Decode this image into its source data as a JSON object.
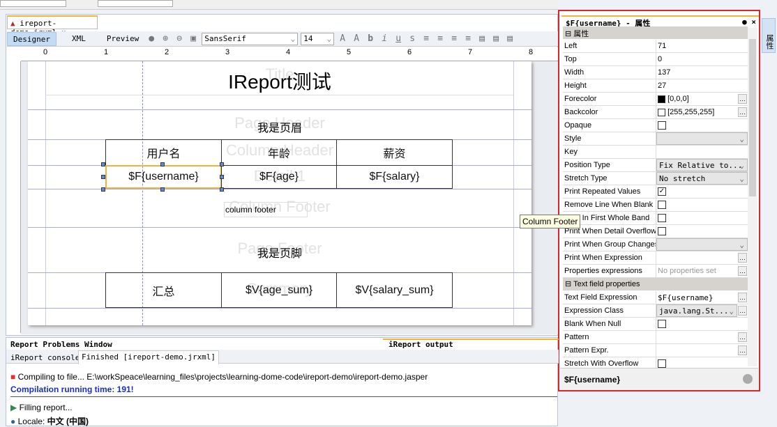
{
  "editor": {
    "file_tab": "ireport-demo.jrxml",
    "view_tabs": [
      "Designer",
      "XML",
      "Preview"
    ],
    "font_family": "SansSerif",
    "font_size": "14",
    "ruler_marks": [
      "0",
      "1",
      "2",
      "3",
      "4",
      "5",
      "6",
      "7",
      "8"
    ]
  },
  "report": {
    "band_labels": [
      "Title",
      "Page Header",
      "Column Header",
      "Detail 1",
      "Column Footer",
      "Page Footer",
      "Summary"
    ],
    "title": "IReport测试",
    "page_header": "我是页眉",
    "column_headers": [
      "用户名",
      "年龄",
      "薪资"
    ],
    "detail_fields": [
      "$F{username}",
      "$F{age}",
      "$F{salary}"
    ],
    "column_footer": "column footer",
    "page_footer": "我是页脚",
    "summary": [
      "汇总",
      "$V{age_sum}",
      "$V{salary_sum}"
    ],
    "tooltip": "Column Footer"
  },
  "properties": {
    "title": "$F{username} - 属性",
    "group1": "属性",
    "rows": [
      {
        "k": "Left",
        "v": "71"
      },
      {
        "k": "Top",
        "v": "0"
      },
      {
        "k": "Width",
        "v": "137"
      },
      {
        "k": "Height",
        "v": "27"
      },
      {
        "k": "Forecolor",
        "v": "[0,0,0]",
        "swatch": "#000000",
        "dots": true
      },
      {
        "k": "Backcolor",
        "v": "[255,255,255]",
        "swatch": "#ffffff",
        "dots": true
      },
      {
        "k": "Opaque",
        "check": false
      },
      {
        "k": "Style",
        "dd": ""
      },
      {
        "k": "Key",
        "v": ""
      },
      {
        "k": "Position Type",
        "dd": "Fix Relative to..."
      },
      {
        "k": "Stretch Type",
        "dd": "No stretch"
      },
      {
        "k": "Print Repeated Values",
        "check": true
      },
      {
        "k": "Remove Line When Blank",
        "check": false
      },
      {
        "k": "Print In First Whole Band",
        "check": false
      },
      {
        "k": "Print When Detail Overflow",
        "check": false
      },
      {
        "k": "Print When Group Changes",
        "dd": ""
      },
      {
        "k": "Print When Expression",
        "v": "",
        "dots": true
      },
      {
        "k": "Properties expressions",
        "v": "No properties set",
        "dots": true,
        "muted": true
      }
    ],
    "group2": "Text field properties",
    "rows2": [
      {
        "k": "Text Field Expression",
        "v": "$F{username}",
        "dots": true,
        "mono": true
      },
      {
        "k": "Expression Class",
        "dd": "java.lang.St...",
        "dots": true
      },
      {
        "k": "Blank When Null",
        "check": false
      },
      {
        "k": "Pattern",
        "v": "",
        "dots": true
      },
      {
        "k": "Pattern Expr.",
        "v": "",
        "dots": true
      },
      {
        "k": "Stretch With Overflow",
        "check": false
      }
    ],
    "footer": "$F{username}",
    "side_tab": "属性"
  },
  "output": {
    "problems_title": "Report Problems Window",
    "output_title": "iReport output",
    "tabs": [
      "iReport console",
      "Finished [ireport-demo.jrxml]"
    ],
    "lines": [
      "Compiling to file... E:\\workSpeace\\learning_files\\projects\\learning-dome-code\\ireport-demo\\ireport-demo.jasper",
      "Compilation running time: 191!",
      "Filling report...",
      "Locale: "
    ],
    "locale_value": "中文 (中国)"
  },
  "colors": {
    "accent": "#f2b33d",
    "highlight": "#d9262c",
    "link": "#1a2fbf"
  }
}
